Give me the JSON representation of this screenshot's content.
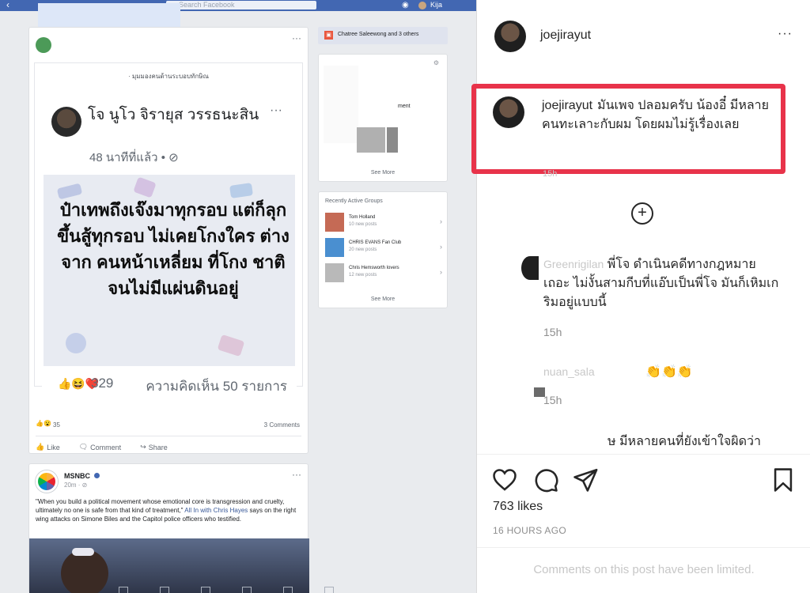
{
  "facebook": {
    "topbar": {
      "back_icon": "chevron-left-icon",
      "search_placeholder": "Search Facebook",
      "user_name": "Kija",
      "messenger_icon": "messenger-icon"
    },
    "post1": {
      "caption": "· มุมมองคนด้านระบอบทักษิณ",
      "more": "···",
      "shared_post": {
        "author": "โจ นูโว จิรายุส วรรธนะสิน",
        "time": "48 นาทีที่แล้ว • ⊘",
        "more": "···",
        "quote": "ป๋าเทพถึงเจ๊งมาทุกรอบ แต่ก็ลุกขึ้นสู้ทุกรอบ ไม่เคยโกงใคร ต่างจาก คนหน้าเหลี่ยม ที่โกง ชาติ จนไม่มีแผ่นดินอยู่",
        "reaction_count": "329",
        "comments": "ความคิดเห็น 50 รายการ"
      },
      "reactions": "35",
      "comments_count": "3 Comments",
      "actions": {
        "like": "Like",
        "comment": "Comment",
        "share": "Share"
      }
    },
    "post2": {
      "page": "MSNBC",
      "time": "20m · ⊘",
      "more": "···",
      "text_before": "\"When you build a political movement whose emotional core is transgression and cruelty, ultimately no one is safe from that kind of treatment,\" ",
      "link": "All In with Chris Hayes",
      "text_after": " says on the right wing attacks on Simone Biles and the Capitol police officers who testified."
    },
    "right_column": {
      "header": "Chatree Saleewong and 3 others",
      "card1_text": "ment",
      "see_more_1": "See More",
      "groups_title": "Recently Active Groups",
      "groups": [
        {
          "name": "Tom Holland",
          "posts": "10 new posts",
          "color": "#c56a55"
        },
        {
          "name": "CHRIS EVANS Fan Club",
          "posts": "20 new posts",
          "color": "#4a8fd0"
        },
        {
          "name": "Chris Hemsworth lovers",
          "posts": "12 new posts",
          "color": "#b9b9b9"
        }
      ],
      "see_more_2": "See More"
    }
  },
  "instagram": {
    "header_user": "joejirayut",
    "header_more": "···",
    "main_comment": {
      "user": "joejirayut",
      "text": "มันเพจ ปลอมครับ น้องอี๋ มีหลายคนทะเลาะกับผม โดยผมไม่รู้เรื่องเลย"
    },
    "main_comment_time": "15h",
    "comment2": {
      "user": "Greenrigilan",
      "text": "พี่โจ ดำเนินคดีทางกฎหมายเถอะ ไม่งั้นสามกีบที่แอ๊บเป็นพี่โจ มันก็เหิมเกริมอยู่แบบนี้",
      "time": "15h"
    },
    "comment3": {
      "user": "nuan_sala",
      "text": "👏👏👏",
      "time": "15h"
    },
    "comment4_text": "ษ มีหลายคนที่ยังเข้าใจผิดว่า",
    "likes": "763 likes",
    "posted": "16 HOURS AGO",
    "limited": "Comments on this post have been limited."
  },
  "colors": {
    "fb_blue": "#4267b2",
    "highlight_red": "#e8334a"
  }
}
